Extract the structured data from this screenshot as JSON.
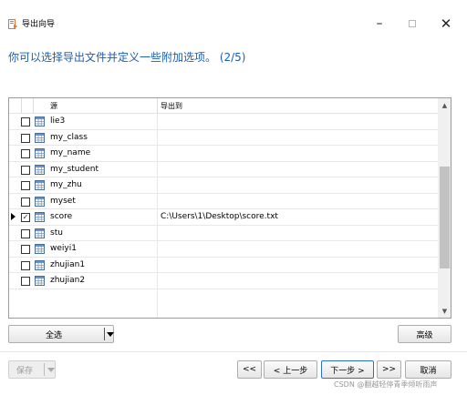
{
  "window": {
    "title": "导出向导",
    "minimize_glyph": "–",
    "close_glyph": "✕"
  },
  "subtitle": "你可以选择导出文件并定义一些附加选项。 (2/5)",
  "table": {
    "columns": {
      "source": "源",
      "destination": "导出到"
    },
    "rows": [
      {
        "name": "lie3",
        "checked": false,
        "destination": ""
      },
      {
        "name": "my_class",
        "checked": false,
        "destination": ""
      },
      {
        "name": "my_name",
        "checked": false,
        "destination": ""
      },
      {
        "name": "my_student",
        "checked": false,
        "destination": ""
      },
      {
        "name": "my_zhu",
        "checked": false,
        "destination": ""
      },
      {
        "name": "myset",
        "checked": false,
        "destination": ""
      },
      {
        "name": "score",
        "checked": true,
        "current": true,
        "destination": "C:\\Users\\1\\Desktop\\score.txt"
      },
      {
        "name": "stu",
        "checked": false,
        "destination": ""
      },
      {
        "name": "weiyi1",
        "checked": false,
        "destination": ""
      },
      {
        "name": "zhujian1",
        "checked": false,
        "destination": ""
      },
      {
        "name": "zhujian2",
        "checked": false,
        "destination": ""
      }
    ],
    "check_glyph": "✓",
    "scroll_up_glyph": "▲",
    "scroll_down_glyph": "▼"
  },
  "buttons": {
    "select_all": "全选",
    "advanced": "高级",
    "save": "保存",
    "first": "<<",
    "prev": "< 上一步",
    "next": "下一步 >",
    "last": ">>",
    "cancel": "取消"
  },
  "watermark": "CSDN @翻越轻停青季倾听雨声",
  "colors": {
    "accent": "#1a5fb4",
    "icon_orange": "#e8742a"
  }
}
